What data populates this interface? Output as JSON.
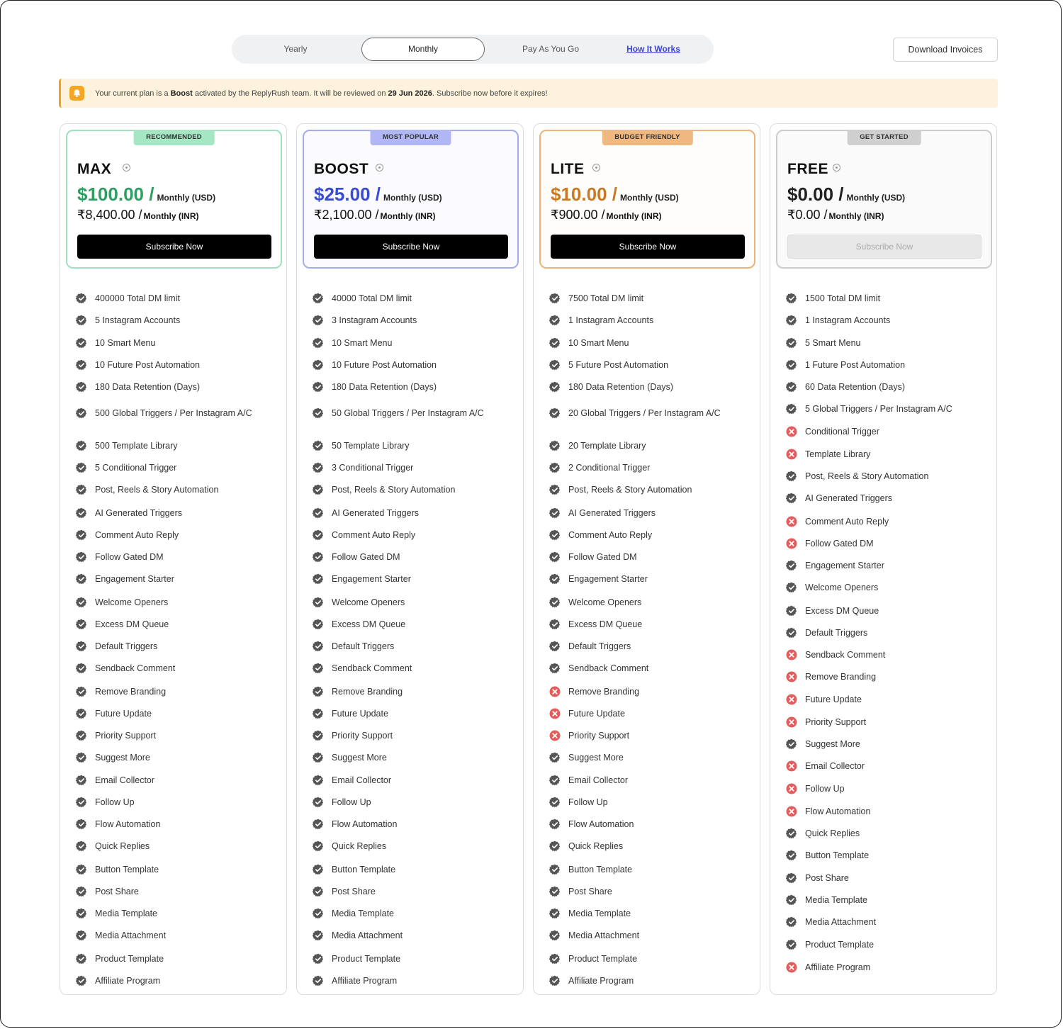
{
  "toggle": {
    "yearly": "Yearly",
    "monthly": "Monthly",
    "payg": "Pay As You Go",
    "how": "How It Works"
  },
  "download_invoices": "Download Invoices",
  "alert": {
    "prefix": "Your current plan is a ",
    "plan": "Boost",
    "middle": " activated by the ReplyRush team. It will be reviewed on ",
    "date": "29 Jun 2026",
    "suffix": ". Subscribe now before it expires!"
  },
  "colors": {
    "max": "#2e9e62",
    "boost": "#3b4bd0",
    "lite": "#c97921",
    "free": "#222222",
    "check": "#555555",
    "cross": "#e35d5d"
  },
  "plans": [
    {
      "badge": "RECOMMENDED",
      "name": "MAX",
      "usd": "$100.00 /",
      "usd_period": "Monthly (USD)",
      "inr": "₹8,400.00 /",
      "inr_period": "Monthly (INR)",
      "button": "Subscribe Now",
      "features": [
        {
          "text": "400000  Total DM limit",
          "ok": true
        },
        {
          "text": "5  Instagram Accounts",
          "ok": true
        },
        {
          "text": "10  Smart Menu",
          "ok": true
        },
        {
          "text": "10  Future Post Automation",
          "ok": true
        },
        {
          "text": "180  Data Retention (Days)",
          "ok": true
        },
        {
          "text": "500  Global Triggers / Per Instagram A/C",
          "ok": true
        },
        {
          "text": "500  Template Library",
          "ok": true
        },
        {
          "text": "5  Conditional Trigger",
          "ok": true
        },
        {
          "text": "Post, Reels & Story Automation",
          "ok": true
        },
        {
          "text": "AI Generated Triggers",
          "ok": true
        },
        {
          "text": "Comment Auto Reply",
          "ok": true
        },
        {
          "text": "Follow Gated DM",
          "ok": true
        },
        {
          "text": "Engagement Starter",
          "ok": true
        },
        {
          "text": "Welcome Openers",
          "ok": true
        },
        {
          "text": "Excess DM Queue",
          "ok": true
        },
        {
          "text": "Default Triggers",
          "ok": true
        },
        {
          "text": "Sendback Comment",
          "ok": true
        },
        {
          "text": "Remove Branding",
          "ok": true
        },
        {
          "text": "Future Update",
          "ok": true
        },
        {
          "text": "Priority Support",
          "ok": true
        },
        {
          "text": "Suggest More",
          "ok": true
        },
        {
          "text": "Email Collector",
          "ok": true
        },
        {
          "text": "Follow Up",
          "ok": true
        },
        {
          "text": "Flow Automation",
          "ok": true
        },
        {
          "text": "Quick Replies",
          "ok": true
        },
        {
          "text": "Button Template",
          "ok": true
        },
        {
          "text": "Post Share",
          "ok": true
        },
        {
          "text": "Media Template",
          "ok": true
        },
        {
          "text": "Media Attachment",
          "ok": true
        },
        {
          "text": "Product Template",
          "ok": true
        },
        {
          "text": "Affiliate Program",
          "ok": true
        }
      ]
    },
    {
      "badge": "MOST POPULAR",
      "name": "BOOST",
      "usd": "$25.00 /",
      "usd_period": "Monthly (USD)",
      "inr": "₹2,100.00 /",
      "inr_period": "Monthly (INR)",
      "button": "Subscribe Now",
      "features": [
        {
          "text": "40000  Total DM limit",
          "ok": true
        },
        {
          "text": "3  Instagram Accounts",
          "ok": true
        },
        {
          "text": "10  Smart Menu",
          "ok": true
        },
        {
          "text": "10  Future Post Automation",
          "ok": true
        },
        {
          "text": "180  Data Retention (Days)",
          "ok": true
        },
        {
          "text": "50  Global Triggers / Per Instagram A/C",
          "ok": true
        },
        {
          "text": "50  Template Library",
          "ok": true
        },
        {
          "text": "3  Conditional Trigger",
          "ok": true
        },
        {
          "text": "Post, Reels & Story Automation",
          "ok": true
        },
        {
          "text": "AI Generated Triggers",
          "ok": true
        },
        {
          "text": "Comment Auto Reply",
          "ok": true
        },
        {
          "text": "Follow Gated DM",
          "ok": true
        },
        {
          "text": "Engagement Starter",
          "ok": true
        },
        {
          "text": "Welcome Openers",
          "ok": true
        },
        {
          "text": "Excess DM Queue",
          "ok": true
        },
        {
          "text": "Default Triggers",
          "ok": true
        },
        {
          "text": "Sendback Comment",
          "ok": true
        },
        {
          "text": "Remove Branding",
          "ok": true
        },
        {
          "text": "Future Update",
          "ok": true
        },
        {
          "text": "Priority Support",
          "ok": true
        },
        {
          "text": "Suggest More",
          "ok": true
        },
        {
          "text": "Email Collector",
          "ok": true
        },
        {
          "text": "Follow Up",
          "ok": true
        },
        {
          "text": "Flow Automation",
          "ok": true
        },
        {
          "text": "Quick Replies",
          "ok": true
        },
        {
          "text": "Button Template",
          "ok": true
        },
        {
          "text": "Post Share",
          "ok": true
        },
        {
          "text": "Media Template",
          "ok": true
        },
        {
          "text": "Media Attachment",
          "ok": true
        },
        {
          "text": "Product Template",
          "ok": true
        },
        {
          "text": "Affiliate Program",
          "ok": true
        }
      ]
    },
    {
      "badge": "BUDGET FRIENDLY",
      "name": "LITE",
      "usd": "$10.00 /",
      "usd_period": "Monthly (USD)",
      "inr": "₹900.00 /",
      "inr_period": "Monthly (INR)",
      "button": "Subscribe Now",
      "features": [
        {
          "text": "7500  Total DM limit",
          "ok": true
        },
        {
          "text": "1  Instagram Accounts",
          "ok": true
        },
        {
          "text": "10  Smart Menu",
          "ok": true
        },
        {
          "text": "5  Future Post Automation",
          "ok": true
        },
        {
          "text": "180  Data Retention (Days)",
          "ok": true
        },
        {
          "text": "20  Global Triggers / Per Instagram A/C",
          "ok": true
        },
        {
          "text": "20  Template Library",
          "ok": true
        },
        {
          "text": "2  Conditional Trigger",
          "ok": true
        },
        {
          "text": "Post, Reels & Story Automation",
          "ok": true
        },
        {
          "text": "AI Generated Triggers",
          "ok": true
        },
        {
          "text": "Comment Auto Reply",
          "ok": true
        },
        {
          "text": "Follow Gated DM",
          "ok": true
        },
        {
          "text": "Engagement Starter",
          "ok": true
        },
        {
          "text": "Welcome Openers",
          "ok": true
        },
        {
          "text": "Excess DM Queue",
          "ok": true
        },
        {
          "text": "Default Triggers",
          "ok": true
        },
        {
          "text": "Sendback Comment",
          "ok": true
        },
        {
          "text": "Remove Branding",
          "ok": false
        },
        {
          "text": "Future Update",
          "ok": false
        },
        {
          "text": "Priority Support",
          "ok": false
        },
        {
          "text": "Suggest More",
          "ok": true
        },
        {
          "text": "Email Collector",
          "ok": true
        },
        {
          "text": "Follow Up",
          "ok": true
        },
        {
          "text": "Flow Automation",
          "ok": true
        },
        {
          "text": "Quick Replies",
          "ok": true
        },
        {
          "text": "Button Template",
          "ok": true
        },
        {
          "text": "Post Share",
          "ok": true
        },
        {
          "text": "Media Template",
          "ok": true
        },
        {
          "text": "Media Attachment",
          "ok": true
        },
        {
          "text": "Product Template",
          "ok": true
        },
        {
          "text": "Affiliate Program",
          "ok": true
        }
      ]
    },
    {
      "badge": "GET STARTED",
      "name": "FREE",
      "usd": "$0.00 /",
      "usd_period": "Monthly (USD)",
      "inr": "₹0.00 /",
      "inr_period": "Monthly (INR)",
      "button": "Subscribe Now",
      "features": [
        {
          "text": "1500  Total DM limit",
          "ok": true
        },
        {
          "text": "1  Instagram Accounts",
          "ok": true
        },
        {
          "text": "5  Smart Menu",
          "ok": true
        },
        {
          "text": "1  Future Post Automation",
          "ok": true
        },
        {
          "text": "60  Data Retention (Days)",
          "ok": true
        },
        {
          "text": "5  Global Triggers / Per Instagram A/C",
          "ok": true
        },
        {
          "text": "Conditional Trigger",
          "ok": false
        },
        {
          "text": "Template Library",
          "ok": false
        },
        {
          "text": "Post, Reels & Story Automation",
          "ok": true
        },
        {
          "text": "AI Generated Triggers",
          "ok": true
        },
        {
          "text": "Comment Auto Reply",
          "ok": false
        },
        {
          "text": "Follow Gated DM",
          "ok": false
        },
        {
          "text": "Engagement Starter",
          "ok": true
        },
        {
          "text": "Welcome Openers",
          "ok": true
        },
        {
          "text": "Excess DM Queue",
          "ok": true
        },
        {
          "text": "Default Triggers",
          "ok": true
        },
        {
          "text": "Sendback Comment",
          "ok": false
        },
        {
          "text": "Remove Branding",
          "ok": false
        },
        {
          "text": "Future Update",
          "ok": false
        },
        {
          "text": "Priority Support",
          "ok": false
        },
        {
          "text": "Suggest More",
          "ok": true
        },
        {
          "text": "Email Collector",
          "ok": false
        },
        {
          "text": "Follow Up",
          "ok": false
        },
        {
          "text": "Flow Automation",
          "ok": false
        },
        {
          "text": "Quick Replies",
          "ok": true
        },
        {
          "text": "Button Template",
          "ok": true
        },
        {
          "text": "Post Share",
          "ok": true
        },
        {
          "text": "Media Template",
          "ok": true
        },
        {
          "text": "Media Attachment",
          "ok": true
        },
        {
          "text": "Product Template",
          "ok": true
        },
        {
          "text": "Affiliate Program",
          "ok": false
        }
      ]
    }
  ]
}
